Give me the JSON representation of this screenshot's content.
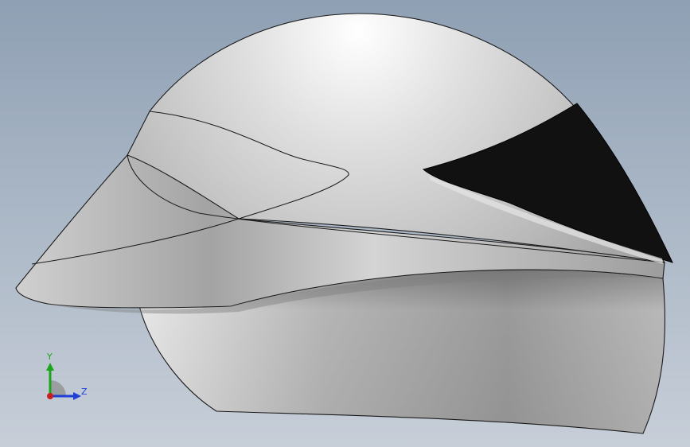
{
  "viewport": {
    "background_top": "#8fa0b4",
    "background_bottom": "#c7ced8"
  },
  "model": {
    "shell_color": "#c9c9c9",
    "visor_color": "#111111",
    "edge_color": "#1a1a1a"
  },
  "triad": {
    "y_label": "Y",
    "z_label": "Z",
    "y_color": "#1aa51a",
    "z_color": "#1f3fd6",
    "x_color": "#c81e1e",
    "icon": "coordinate-triad-icon"
  }
}
